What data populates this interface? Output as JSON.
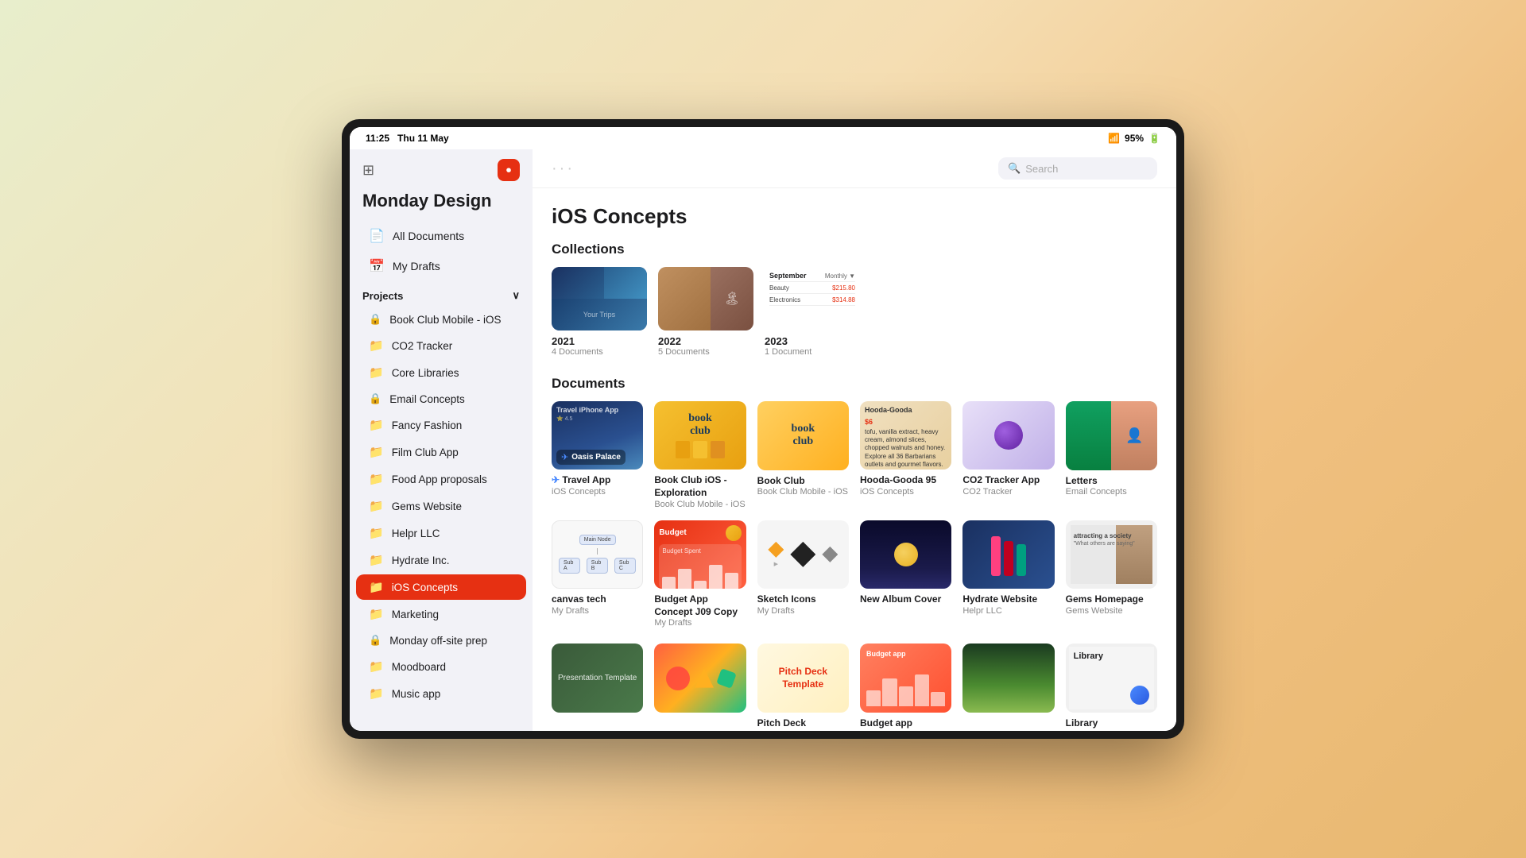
{
  "device": {
    "status_bar": {
      "time": "11:25",
      "date": "Thu 11 May",
      "wifi": "95%",
      "battery": "95%"
    }
  },
  "sidebar": {
    "workspace_title": "Monday Design",
    "nav_items": [
      {
        "label": "All Documents",
        "icon": "📄"
      },
      {
        "label": "My Drafts",
        "icon": "📅"
      }
    ],
    "projects_label": "Projects",
    "projects": [
      {
        "label": "Book Club Mobile - iOS",
        "type": "lock"
      },
      {
        "label": "CO2 Tracker",
        "type": "folder"
      },
      {
        "label": "Core Libraries",
        "type": "folder"
      },
      {
        "label": "Email Concepts",
        "type": "lock"
      },
      {
        "label": "Fancy Fashion",
        "type": "folder"
      },
      {
        "label": "Film Club App",
        "type": "folder"
      },
      {
        "label": "Food App proposals",
        "type": "folder"
      },
      {
        "label": "Gems Website",
        "type": "folder"
      },
      {
        "label": "Helpr LLC",
        "type": "folder"
      },
      {
        "label": "Hydrate Inc.",
        "type": "folder"
      },
      {
        "label": "iOS Concepts",
        "type": "folder",
        "active": true
      },
      {
        "label": "Marketing",
        "type": "folder"
      },
      {
        "label": "Monday off-site prep",
        "type": "lock"
      },
      {
        "label": "Moodboard",
        "type": "folder"
      },
      {
        "label": "Music app",
        "type": "folder"
      }
    ]
  },
  "main": {
    "header": {
      "dots": "···",
      "search_placeholder": "Search"
    },
    "page_title": "iOS Concepts",
    "collections_label": "Collections",
    "collections": [
      {
        "year": "2021",
        "count": "4 Documents"
      },
      {
        "year": "2022",
        "count": "5 Documents"
      },
      {
        "year": "2023",
        "count": "1 Document"
      }
    ],
    "documents_label": "Documents",
    "documents": [
      {
        "title": "Travel App",
        "subtitle": "iOS Concepts",
        "bg": "travel"
      },
      {
        "title": "Book Club iOS - Exploration",
        "subtitle": "Book Club Mobile - iOS",
        "bg": "bookclub"
      },
      {
        "title": "Book Club",
        "subtitle": "Book Club Mobile - iOS",
        "bg": "bookclub2"
      },
      {
        "title": "Hooda-Gooda 95",
        "subtitle": "iOS Concepts",
        "bg": "hooda"
      },
      {
        "title": "CO2 Tracker App",
        "subtitle": "CO2 Tracker",
        "bg": "co2"
      },
      {
        "title": "Letters",
        "subtitle": "Email Concepts",
        "bg": "letters"
      },
      {
        "title": "canvas tech",
        "subtitle": "My Drafts",
        "bg": "canvas"
      },
      {
        "title": "Budget App Concept J09 Copy",
        "subtitle": "My Drafts",
        "bg": "budget"
      },
      {
        "title": "Sketch Icons",
        "subtitle": "My Drafts",
        "bg": "sketch"
      },
      {
        "title": "New Album Cover",
        "subtitle": "",
        "bg": "album"
      },
      {
        "title": "Hydrate Website",
        "subtitle": "Helpr LLC",
        "bg": "hydrate"
      },
      {
        "title": "Gems Homepage",
        "subtitle": "Gems Website",
        "bg": "gems"
      }
    ],
    "bottom_documents": [
      {
        "title": "Presentation Template",
        "subtitle": "",
        "bg": "presentation"
      },
      {
        "title": "",
        "subtitle": "",
        "bg": "colorful"
      },
      {
        "title": "Pitch Deck Template",
        "subtitle": "",
        "bg": "pitchdeck"
      },
      {
        "title": "Budget app",
        "subtitle": "",
        "bg": "budgetapp"
      },
      {
        "title": "",
        "subtitle": "",
        "bg": "nature"
      },
      {
        "title": "Library",
        "subtitle": "",
        "bg": "library"
      }
    ]
  }
}
